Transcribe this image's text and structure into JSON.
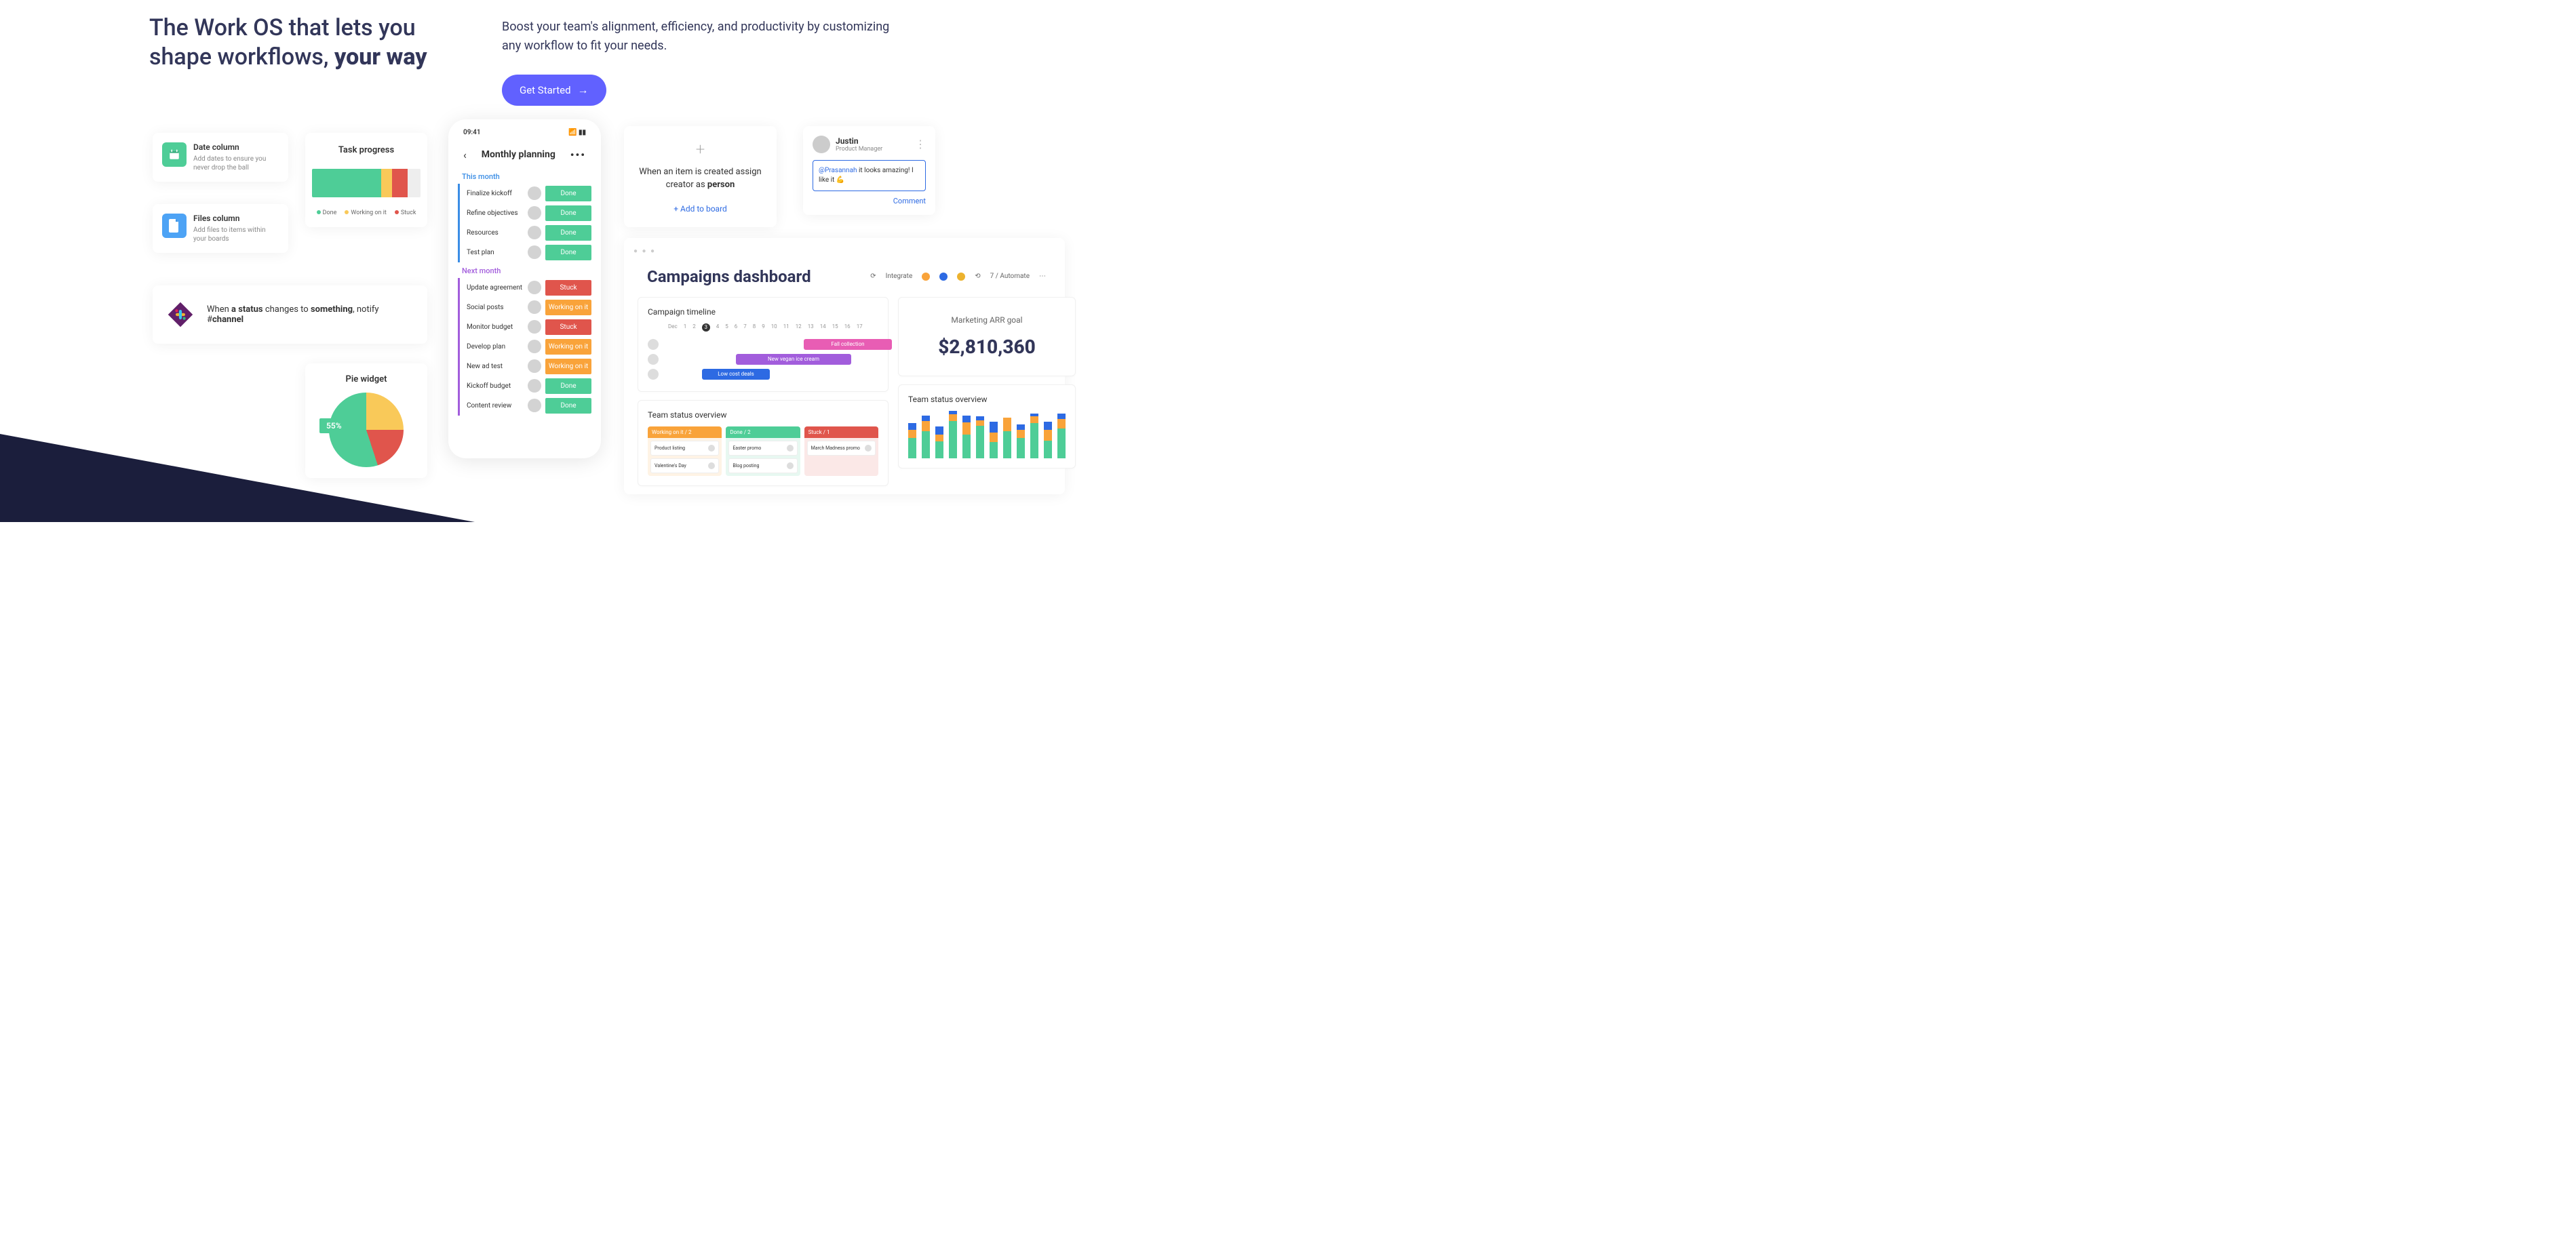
{
  "hero": {
    "title_prefix": "The Work OS that lets you shape workflows, ",
    "title_emphasis": "your way",
    "subtitle": "Boost your team's alignment, efficiency, and productivity by customizing any workflow to fit your needs.",
    "cta": "Get Started"
  },
  "column_cards": [
    {
      "title": "Date column",
      "desc": "Add dates to ensure you never drop the ball"
    },
    {
      "title": "Files column",
      "desc": "Add files to items within your boards"
    }
  ],
  "task_progress": {
    "title": "Task progress",
    "legend": {
      "done": "Done",
      "working": "Working on it",
      "stuck": "Stuck"
    }
  },
  "slack": {
    "text_parts": {
      "p1": "When ",
      "p2": "a status",
      "p3": " changes to ",
      "p4": "something",
      "p5": ", notify #",
      "p6": "channel"
    }
  },
  "pie": {
    "title": "Pie widget",
    "badge": "55%"
  },
  "phone": {
    "time": "09:41",
    "title": "Monthly planning",
    "group1": "This month",
    "group2": "Next month",
    "tasks1": [
      {
        "name": "Finalize kickoff",
        "status": "Done",
        "cls": "st-done"
      },
      {
        "name": "Refine objectives",
        "status": "Done",
        "cls": "st-done"
      },
      {
        "name": "Resources",
        "status": "Done",
        "cls": "st-done"
      },
      {
        "name": "Test plan",
        "status": "Done",
        "cls": "st-done"
      }
    ],
    "tasks2": [
      {
        "name": "Update agreement",
        "status": "Stuck",
        "cls": "st-stuck"
      },
      {
        "name": "Social posts",
        "status": "Working on it",
        "cls": "st-work"
      },
      {
        "name": "Monitor budget",
        "status": "Stuck",
        "cls": "st-stuck"
      },
      {
        "name": "Develop plan",
        "status": "Working on it",
        "cls": "st-work"
      },
      {
        "name": "New ad test",
        "status": "Working on it",
        "cls": "st-work"
      },
      {
        "name": "Kickoff budget",
        "status": "Done",
        "cls": "st-done"
      },
      {
        "name": "Content review",
        "status": "Done",
        "cls": "st-done"
      }
    ]
  },
  "automation": {
    "p1": "When an item is created assign creator as ",
    "p2": "person",
    "link": "+ Add to board"
  },
  "comment": {
    "name": "Justin",
    "role": "Product Manager",
    "mention": "@Prasannah",
    "text": " it looks amazing! I like it 💪",
    "link": "Comment"
  },
  "dashboard": {
    "title": "Campaigns dashboard",
    "integrate": "Integrate",
    "automate": "7 / Automate",
    "timeline": {
      "title": "Campaign timeline",
      "labels": [
        "Dec",
        "1",
        "2",
        "3",
        "4",
        "5",
        "6",
        "7",
        "8",
        "9",
        "10",
        "11",
        "12",
        "13",
        "14",
        "15",
        "16",
        "17"
      ],
      "bars": [
        {
          "label": "Fall collection",
          "color": "#e85db4",
          "left": 230,
          "width": 130
        },
        {
          "label": "New vegan ice cream",
          "color": "#a25ddc",
          "left": 130,
          "width": 170
        },
        {
          "label": "Low cost deals",
          "color": "#2d6ae3",
          "left": 80,
          "width": 100
        }
      ]
    },
    "arr": {
      "label": "Marketing ARR goal",
      "value": "$2,810,360"
    },
    "tso1": {
      "title": "Team status overview",
      "cols": [
        {
          "head": "Working on it / 2",
          "color": "#f9a33a",
          "items": [
            "Product listing",
            "Valentine's Day"
          ]
        },
        {
          "head": "Done / 2",
          "color": "#4ecd97",
          "items": [
            "Easter promo",
            "Blog posting"
          ]
        },
        {
          "head": "Stuck / 1",
          "color": "#e0554c",
          "items": [
            "March Madness promo"
          ]
        }
      ]
    },
    "tso2": {
      "title": "Team status overview"
    }
  },
  "chart_data": [
    {
      "type": "bar",
      "title": "Task progress",
      "series": [
        {
          "name": "Done",
          "values": [
            64
          ]
        },
        {
          "name": "Working on it",
          "values": [
            10
          ]
        },
        {
          "name": "Stuck",
          "values": [
            14
          ]
        },
        {
          "name": "Other",
          "values": [
            12
          ]
        }
      ],
      "orientation": "horizontal-stacked"
    },
    {
      "type": "pie",
      "title": "Pie widget",
      "series": [
        {
          "name": "Green",
          "values": [
            55
          ]
        },
        {
          "name": "Yellow",
          "values": [
            25
          ]
        },
        {
          "name": "Red",
          "values": [
            20
          ]
        }
      ]
    },
    {
      "type": "bar",
      "title": "Team status overview (stacked bars)",
      "categories": [
        "1",
        "2",
        "3",
        "4",
        "5",
        "6",
        "7",
        "8",
        "9",
        "10",
        "11",
        "12"
      ],
      "series": [
        {
          "name": "Done",
          "color": "#4ecd97"
        },
        {
          "name": "Working on it",
          "color": "#f9a33a"
        },
        {
          "name": "Stuck",
          "color": "#2d6ae3"
        }
      ],
      "note": "approximate stacked heights, values not labeled"
    }
  ]
}
